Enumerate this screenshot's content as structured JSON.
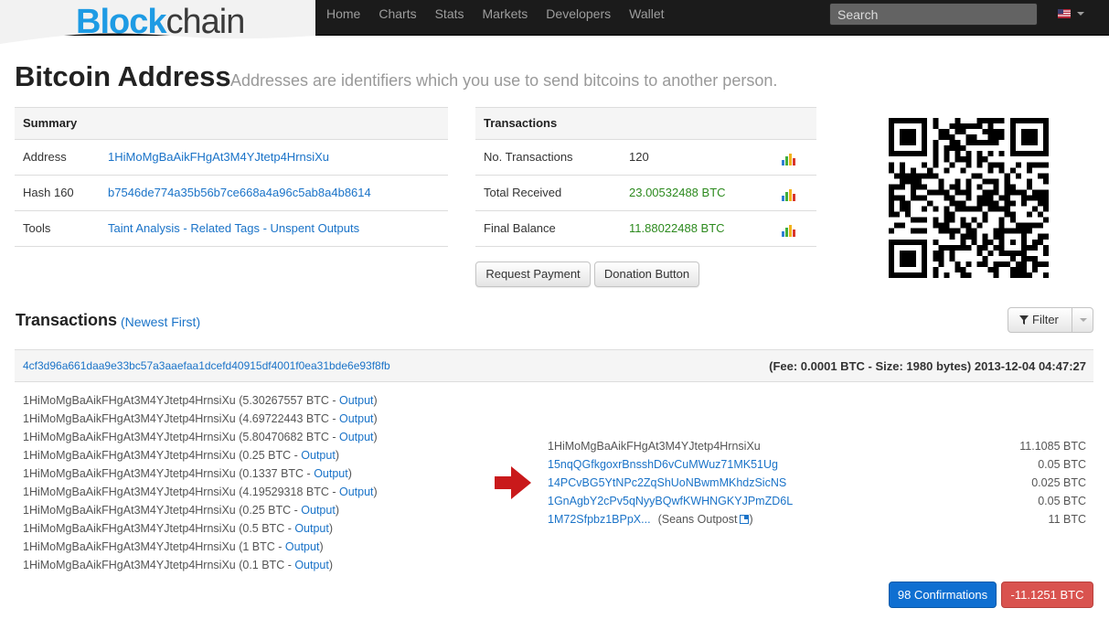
{
  "brand": {
    "logo_part1": "Blo",
    "logo_part2": "c",
    "logo_part3": "k",
    "logo_part4": "chain"
  },
  "nav": {
    "items": [
      {
        "label": "Home"
      },
      {
        "label": "Charts"
      },
      {
        "label": "Stats"
      },
      {
        "label": "Markets"
      },
      {
        "label": "Developers"
      },
      {
        "label": "Wallet"
      }
    ],
    "search_placeholder": "Search",
    "language_flag": "us-flag-icon"
  },
  "header": {
    "title": "Bitcoin Address",
    "subtitle": "Addresses are identifiers which you use to send bitcoins to another person."
  },
  "summary": {
    "heading": "Summary",
    "address_label": "Address",
    "address_value": "1HiMoMgBaAikFHgAt3M4YJtetp4HrnsiXu",
    "hash160_label": "Hash 160",
    "hash160_value": "b7546de774a35b56b7ce668a4a96c5ab8a4b8614",
    "tools_label": "Tools",
    "tools": {
      "taint": "Taint Analysis",
      "sep1": " - ",
      "related": "Related Tags",
      "sep2": " - ",
      "unspent": "Unspent Outputs"
    }
  },
  "transactions_box": {
    "heading": "Transactions",
    "n_tx_label": "No. Transactions",
    "n_tx_value": "120",
    "received_label": "Total Received",
    "received_value": "23.00532488 BTC",
    "balance_label": "Final Balance",
    "balance_value": "11.88022488 BTC"
  },
  "buttons": {
    "request_payment": "Request Payment",
    "donation_button": "Donation Button"
  },
  "tx_section": {
    "title": "Transactions",
    "order": "(Newest First)",
    "filter": "Filter"
  },
  "tx": {
    "hash": "4cf3d96a661daa9e33bc57a3aaefaa1dcefd40915df4001f0ea31bde6e93f8fb",
    "meta": "(Fee: 0.0001 BTC - Size: 1980 bytes) 2013-12-04 04:47:27",
    "inputs": [
      {
        "addr": "1HiMoMgBaAikFHgAt3M4YJtetp4HrnsiXu",
        "amount": " (5.30267557 BTC - ",
        "link": "Output",
        "close": ")"
      },
      {
        "addr": "1HiMoMgBaAikFHgAt3M4YJtetp4HrnsiXu",
        "amount": " (4.69722443 BTC - ",
        "link": "Output",
        "close": ")"
      },
      {
        "addr": "1HiMoMgBaAikFHgAt3M4YJtetp4HrnsiXu",
        "amount": " (5.80470682 BTC - ",
        "link": "Output",
        "close": ")"
      },
      {
        "addr": "1HiMoMgBaAikFHgAt3M4YJtetp4HrnsiXu",
        "amount": " (0.25 BTC - ",
        "link": "Output",
        "close": ")"
      },
      {
        "addr": "1HiMoMgBaAikFHgAt3M4YJtetp4HrnsiXu",
        "amount": " (0.1337 BTC - ",
        "link": "Output",
        "close": ")"
      },
      {
        "addr": "1HiMoMgBaAikFHgAt3M4YJtetp4HrnsiXu",
        "amount": " (4.19529318 BTC - ",
        "link": "Output",
        "close": ")"
      },
      {
        "addr": "1HiMoMgBaAikFHgAt3M4YJtetp4HrnsiXu",
        "amount": " (0.25 BTC - ",
        "link": "Output",
        "close": ")"
      },
      {
        "addr": "1HiMoMgBaAikFHgAt3M4YJtetp4HrnsiXu",
        "amount": " (0.5 BTC - ",
        "link": "Output",
        "close": ")"
      },
      {
        "addr": "1HiMoMgBaAikFHgAt3M4YJtetp4HrnsiXu",
        "amount": " (1 BTC - ",
        "link": "Output",
        "close": ")"
      },
      {
        "addr": "1HiMoMgBaAikFHgAt3M4YJtetp4HrnsiXu",
        "amount": " (0.1 BTC - ",
        "link": "Output",
        "close": ")"
      }
    ],
    "outputs": [
      {
        "addr": "1HiMoMgBaAikFHgAt3M4YJtetp4HrnsiXu",
        "amount": "11.1085 BTC"
      },
      {
        "addr": "15nqQGfkgoxrBnsshD6vCuMWuz71MK51Ug",
        "amount": "0.05 BTC"
      },
      {
        "addr": "14PCvBG5YtNPc2ZqShUoNBwmMKhdzSicNS",
        "amount": "0.025 BTC"
      },
      {
        "addr": "1GnAgbY2cPv5qNyyBQwfKWHNGKYJPmZD6L",
        "amount": "0.05 BTC"
      },
      {
        "addr": "1M72Sfpbz1BPpX...",
        "tag": "(Seans Outpost",
        "tag_close": ")",
        "amount": "11 BTC"
      }
    ],
    "confirmations": "98 Confirmations",
    "net_amount": "-11.1251 BTC"
  },
  "colors": {
    "accent_link": "#1a73c8",
    "green": "#2c8a1e",
    "confirm_blue": "#0f6fd1",
    "negative_red": "#d9534f",
    "arrow_red": "#c9191b"
  }
}
